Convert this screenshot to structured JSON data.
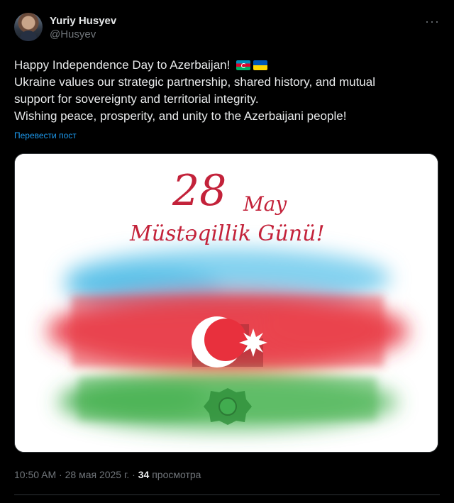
{
  "author": {
    "name": "Yuriy Husyev",
    "handle": "@Husyev"
  },
  "tweet": {
    "line1": "Happy Independence Day to Azerbaijan!",
    "line2": "Ukraine values our strategic partnership, shared history, and mutual",
    "line3": "support for sovereignty and territorial integrity.",
    "line4": "Wishing peace, prosperity, and unity to the Azerbaijani people!",
    "emoji_flags": [
      "flag-azerbaijan-icon",
      "flag-ukraine-icon"
    ]
  },
  "translate_label": "Перевести пост",
  "image": {
    "date_number": "28",
    "date_month": "May",
    "title": "Müstəqillik Günü!",
    "colors": {
      "blue": "#3fb6e3",
      "red": "#e8303d",
      "green": "#3aa84a"
    }
  },
  "meta": {
    "time": "10:50 AM",
    "date": "28 мая 2025 г.",
    "views_count": "34",
    "views_label": "просмотра"
  },
  "more_icon": "ellipsis-icon"
}
